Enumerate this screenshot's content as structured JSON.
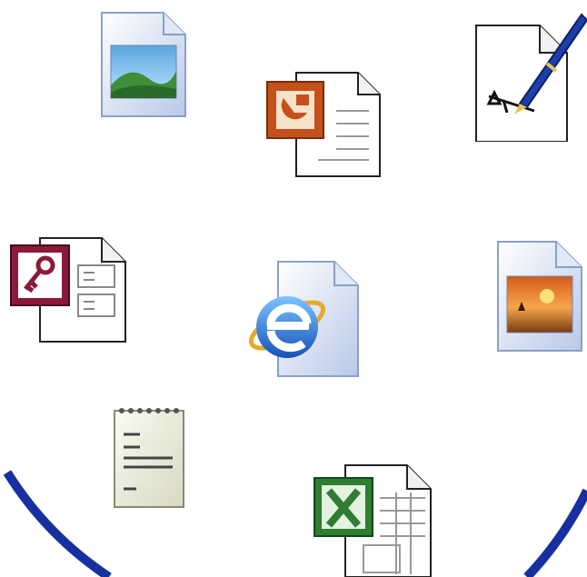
{
  "icons": [
    {
      "name": "image-file-icon"
    },
    {
      "name": "powerpoint-file-icon"
    },
    {
      "name": "signature-file-icon"
    },
    {
      "name": "access-file-icon"
    },
    {
      "name": "internet-explorer-file-icon"
    },
    {
      "name": "photo-file-icon"
    },
    {
      "name": "notepad-file-icon"
    },
    {
      "name": "excel-file-icon"
    }
  ],
  "colors": {
    "background": "#ffffff",
    "arc": "#1730a0",
    "powerpoint": "#c4511b",
    "access": "#8b1a3a",
    "excel": "#2e7d32",
    "ie": "#1f6fd1"
  }
}
